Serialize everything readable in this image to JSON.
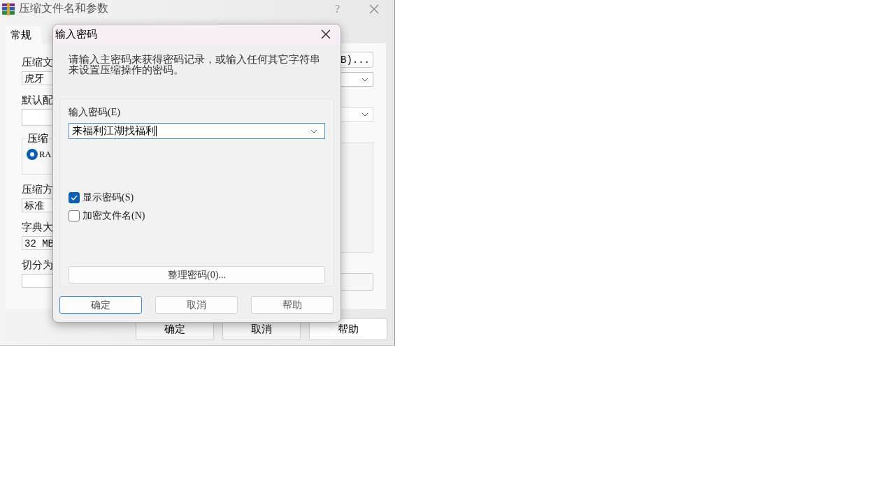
{
  "main_window": {
    "title": "压缩文件名和参数",
    "help_glyph": "?",
    "tabs": [
      {
        "label": "常规",
        "selected": true
      }
    ],
    "left_items": [
      {
        "kind": "label",
        "text": "压缩文"
      },
      {
        "kind": "field",
        "value": "虎牙"
      },
      {
        "kind": "label",
        "text": "默认配"
      },
      {
        "kind": "empty_field"
      },
      {
        "kind": "group",
        "legend": "压缩",
        "radio": {
          "label": "RA",
          "selected": true
        }
      },
      {
        "kind": "label",
        "text": "压缩方"
      },
      {
        "kind": "field",
        "value": "标准"
      },
      {
        "kind": "label",
        "text": "字典大"
      },
      {
        "kind": "field",
        "value": "32 MB"
      },
      {
        "kind": "label",
        "text": "切分为"
      },
      {
        "kind": "empty_field"
      }
    ],
    "right_items": [
      {
        "kind": "button",
        "label": "B)..."
      },
      {
        "kind": "dropdown"
      },
      {
        "kind": "dropdown"
      },
      {
        "kind": "listbox"
      },
      {
        "kind": "empty_field"
      }
    ],
    "buttons": [
      "确定",
      "取消",
      "帮助"
    ]
  },
  "password_dialog": {
    "title": "输入密码",
    "instructions": "请输入主密码来获得密码记录，或输入任何其它字符串来设置压缩操作的密码。",
    "password_label": "输入密码(E)",
    "password_value": "来福利江湖找福利",
    "options": [
      {
        "label": "显示密码(S)",
        "checked": true
      },
      {
        "label": "加密文件名(N)",
        "checked": false
      }
    ],
    "organize_button": "整理密码(0)...",
    "buttons": [
      {
        "label": "确定",
        "default": true
      },
      {
        "label": "取消",
        "default": false
      },
      {
        "label": "帮助",
        "default": false
      }
    ]
  }
}
